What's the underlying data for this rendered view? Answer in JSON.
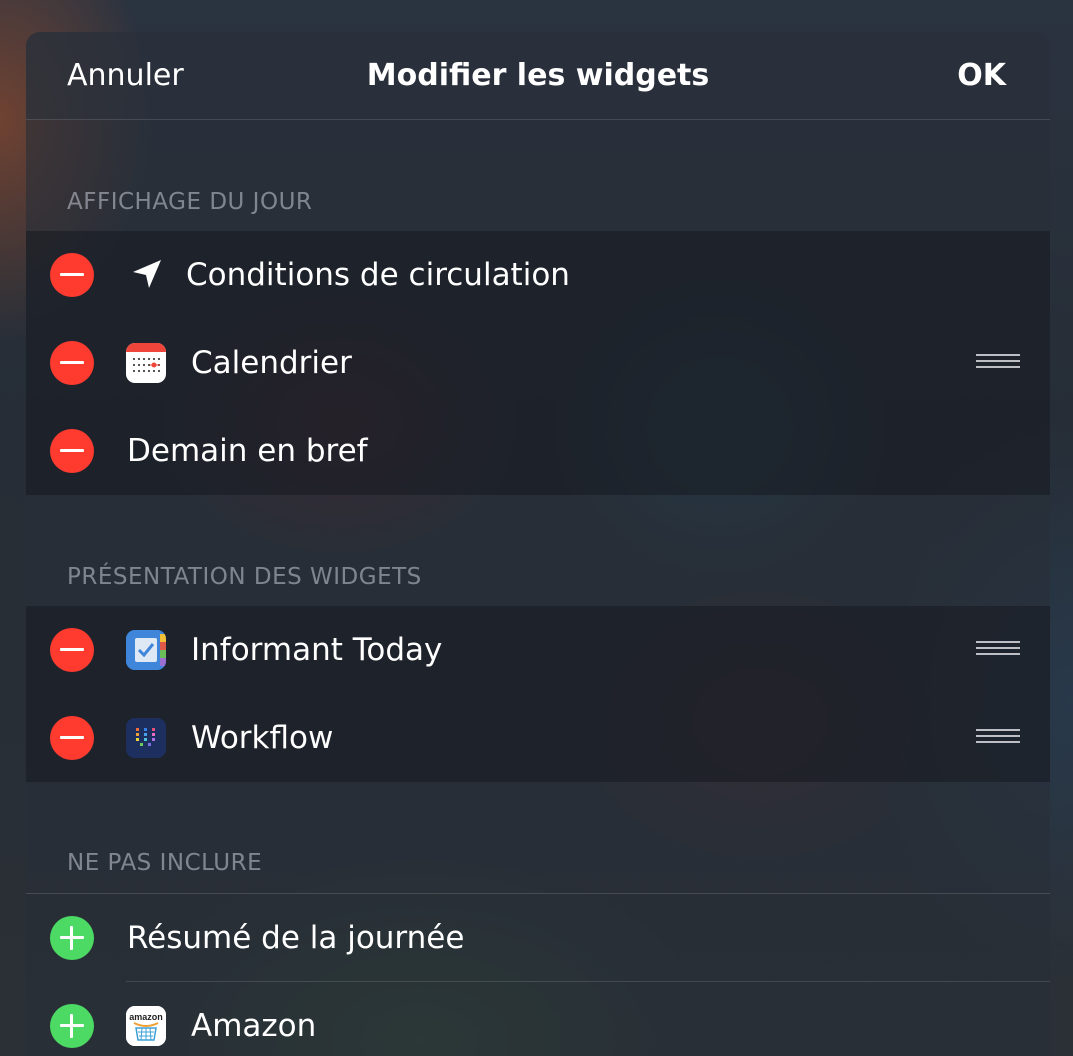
{
  "navbar": {
    "cancel_label": "Annuler",
    "title": "Modifier les widgets",
    "done_label": "OK"
  },
  "sections": {
    "today": {
      "header": "AFFICHAGE DU JOUR",
      "items": [
        {
          "label": "Conditions de circulation",
          "icon": "location-arrow-icon"
        },
        {
          "label": "Calendrier",
          "icon": "calendar-app-icon"
        },
        {
          "label": "Demain en bref"
        }
      ]
    },
    "widgets": {
      "header": "PRÉSENTATION DES WIDGETS",
      "items": [
        {
          "label": "Informant Today",
          "icon": "informant-app-icon"
        },
        {
          "label": "Workflow",
          "icon": "workflow-app-icon"
        }
      ]
    },
    "excluded": {
      "header": "NE PAS INCLURE",
      "items": [
        {
          "label": "Résumé de la journée"
        },
        {
          "label": "Amazon",
          "icon": "amazon-app-icon"
        }
      ]
    }
  },
  "calendar_icon_text": "",
  "amazon_icon_text": "amazon",
  "colors": {
    "remove": "#ff3b30",
    "add": "#4cd964",
    "text": "#ffffff",
    "section_header": "#9aa3b0"
  }
}
